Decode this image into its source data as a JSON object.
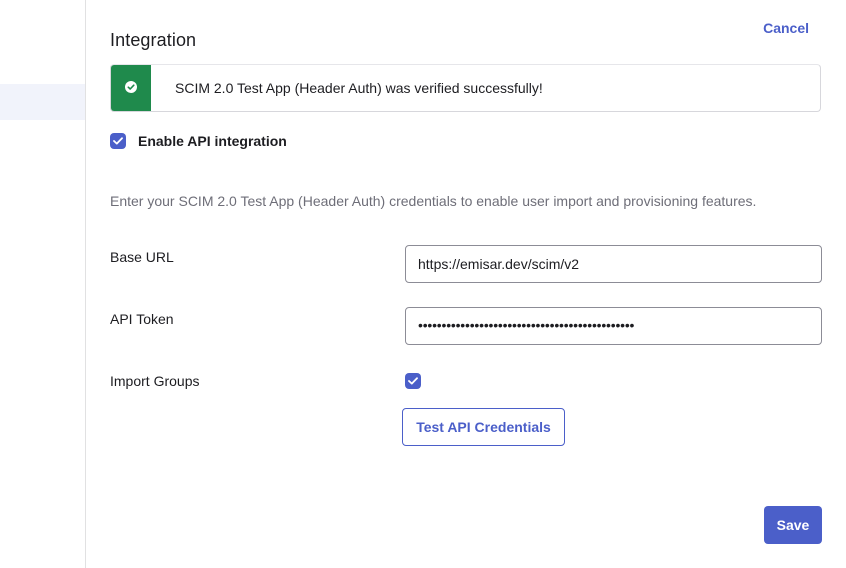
{
  "header": {
    "title": "Integration",
    "cancel_label": "Cancel"
  },
  "banner": {
    "status": "success",
    "icon": "check-circle-icon",
    "message": "SCIM 2.0 Test App (Header Auth) was verified successfully!",
    "color": "#1f8a4c"
  },
  "enable_api": {
    "label": "Enable API integration",
    "checked": true
  },
  "description": "Enter your SCIM 2.0 Test App (Header Auth) credentials to enable user import and provisioning features.",
  "fields": {
    "base_url": {
      "label": "Base URL",
      "value": "https://emisar.dev/scim/v2"
    },
    "api_token": {
      "label": "API Token",
      "masked_value": "••••••••••••••••••••••••••••••••••••••••••••••"
    },
    "import_groups": {
      "label": "Import Groups",
      "checked": true
    }
  },
  "buttons": {
    "test_credentials": "Test API Credentials",
    "save": "Save"
  },
  "colors": {
    "accent": "#4b5fc9",
    "success": "#1f8a4c"
  }
}
